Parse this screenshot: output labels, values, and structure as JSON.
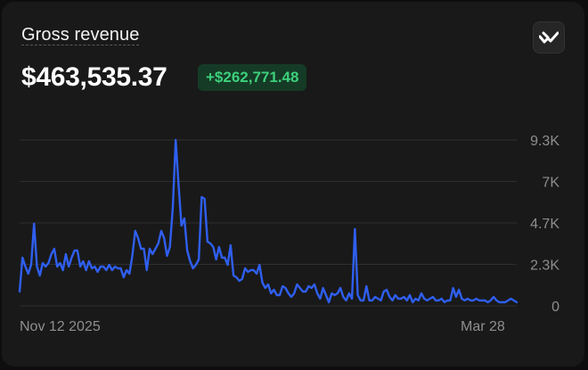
{
  "card": {
    "title": "Gross revenue",
    "value": "$463,535.37",
    "delta": "+$262,771.48"
  },
  "logo": {
    "icon": "brand-logo-icon"
  },
  "colors": {
    "line": "#2f5ff0",
    "delta_text": "#3ed07c",
    "delta_bg": "#153b26"
  },
  "chart_data": {
    "type": "line",
    "title": "",
    "xlabel": "",
    "ylabel": "",
    "ylim": [
      0,
      9300
    ],
    "y_ticks": [
      "9.3K",
      "7K",
      "4.7K",
      "2.3K",
      "0"
    ],
    "x_ticks": [
      "Nov 12 2025",
      "Mar 28"
    ],
    "grid": true,
    "series": [
      {
        "values": [
          800,
          2700,
          2200,
          1800,
          2300,
          4600,
          2200,
          1700,
          2400,
          2200,
          2400,
          2900,
          3200,
          2200,
          2400,
          2000,
          2900,
          2200,
          2700,
          3100,
          3100,
          2200,
          2500,
          2000,
          2500,
          2100,
          2200,
          1900,
          2200,
          2200,
          2000,
          2300,
          2000,
          2200,
          2100,
          2100,
          1600,
          2000,
          1800,
          2800,
          4200,
          3800,
          3200,
          3200,
          2000,
          3200,
          2900,
          3200,
          3500,
          4200,
          3800,
          2800,
          3300,
          5500,
          9300,
          6800,
          4500,
          4900,
          3100,
          2500,
          2100,
          2300,
          2600,
          6100,
          6000,
          3600,
          3500,
          3300,
          2600,
          3300,
          2700,
          2700,
          2300,
          3400,
          1700,
          1600,
          1400,
          1500,
          2100,
          1900,
          2000,
          2000,
          1800,
          2300,
          1300,
          1000,
          1200,
          700,
          900,
          600,
          600,
          1100,
          1000,
          700,
          500,
          700,
          1200,
          1000,
          800,
          800,
          1100,
          1000,
          1200,
          700,
          400,
          1000,
          600,
          200,
          700,
          600,
          700,
          1000,
          500,
          300,
          700,
          400,
          4300,
          600,
          300,
          300,
          1100,
          300,
          300,
          500,
          400,
          300,
          800,
          900,
          500,
          300,
          600,
          400,
          400,
          500,
          300,
          600,
          200,
          400,
          300,
          700,
          400,
          300,
          400,
          500,
          300,
          300,
          400,
          200,
          300,
          300,
          1000,
          500,
          900,
          400,
          300,
          400,
          300,
          300,
          400,
          300,
          300,
          300,
          200,
          300,
          500,
          300,
          200,
          200,
          200,
          300,
          400,
          300,
          200
        ]
      }
    ]
  }
}
